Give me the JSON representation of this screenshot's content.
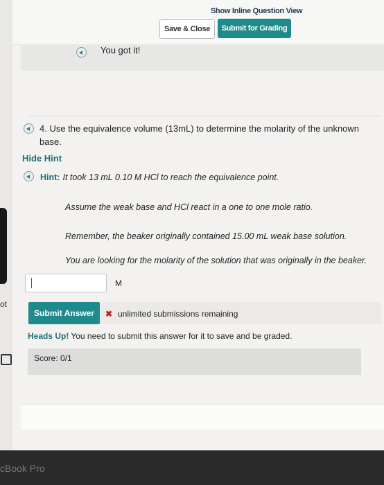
{
  "header": {
    "inline_view_link": "Show Inline Question View",
    "save_close_label": "Save & Close",
    "submit_grading_label": "Submit for Grading"
  },
  "feedback": {
    "text": "You got it!"
  },
  "question": {
    "text": "4. Use the equivalence volume (13mL) to determine the molarity of the unknown base."
  },
  "hint": {
    "toggle_label": "Hide Hint",
    "label": "Hint:",
    "line1": "It took 13 mL 0.10 M HCl to reach the equivalence point.",
    "line2": "Assume the weak base and HCl react in a one to one mole ratio.",
    "line3": "Remember, the beaker originally contained 15.00 mL weak base solution.",
    "line4": "You are looking for the molarity of the solution that was originally in the beaker."
  },
  "answer": {
    "value": "",
    "unit": "M",
    "submit_label": "Submit Answer",
    "submissions_text": "unlimited submissions remaining",
    "headsup_label": "Heads Up!",
    "headsup_text": "You need to submit this answer for it to save and be graded.",
    "score": "Score: 0/1"
  },
  "side": {
    "text": "ot"
  },
  "device": {
    "brand": "cBook Pro"
  }
}
